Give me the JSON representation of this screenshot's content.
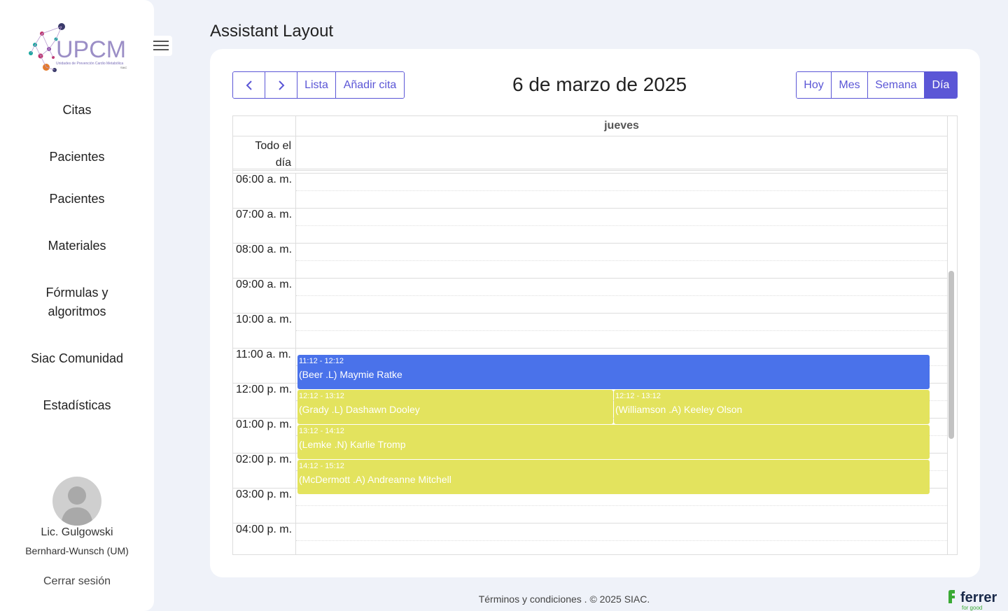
{
  "sidebar": {
    "logo_text": "UPCM",
    "logo_subtitle": "Unidades de Prevención Cardio Metabólica",
    "logo_tag": "SIAC",
    "items": [
      {
        "label": "Citas"
      },
      {
        "label": "Pacientes"
      },
      {
        "label": "Pacientes"
      },
      {
        "label": "Materiales"
      },
      {
        "label": "Fórmulas y algoritmos"
      },
      {
        "label": "Siac Comunidad"
      },
      {
        "label": "Estadísticas"
      }
    ],
    "user_name": "Lic. Gulgowski",
    "user_org": "Bernhard-Wunsch (UM)",
    "logout": "Cerrar sesión"
  },
  "page": {
    "title": "Assistant Layout"
  },
  "toolbar": {
    "prev_icon": "chevron-left-icon",
    "next_icon": "chevron-right-icon",
    "list_label": "Lista",
    "add_label": "Añadir cita",
    "title": "6 de marzo de 2025",
    "views": [
      {
        "label": "Hoy",
        "active": false
      },
      {
        "label": "Mes",
        "active": false
      },
      {
        "label": "Semana",
        "active": false
      },
      {
        "label": "Día",
        "active": true
      }
    ]
  },
  "calendar": {
    "day_header": "jueves",
    "allday_label": "Todo el día",
    "times": [
      "06:00 a. m.",
      "07:00 a. m.",
      "08:00 a. m.",
      "09:00 a. m.",
      "10:00 a. m.",
      "11:00 a. m.",
      "12:00 p. m.",
      "01:00 p. m.",
      "02:00 p. m.",
      "03:00 p. m.",
      "04:00 p. m."
    ],
    "events": [
      {
        "time": "11:12 - 12:12",
        "title": "(Beer .L) Maymie Ratke",
        "color": "#4a72ea"
      },
      {
        "time": "12:12 - 13:12",
        "title": "(Grady .L) Dashawn Dooley",
        "color": "#e3e35e"
      },
      {
        "time": "12:12 - 13:12",
        "title": "(Williamson .A) Keeley Olson",
        "color": "#e3e35e"
      },
      {
        "time": "13:12 - 14:12",
        "title": "(Lemke .N) Karlie Tromp",
        "color": "#e3e35e"
      },
      {
        "time": "14:12 - 15:12",
        "title": "(McDermott .A) Andreanne Mitchell",
        "color": "#e3e35e"
      }
    ]
  },
  "footer": {
    "text": "Términos y condiciones . © 2025 SIAC."
  },
  "brand": {
    "name": "ferrer",
    "tagline": "for good"
  },
  "colors": {
    "accent": "#5b56d6",
    "background": "#eff2f9"
  }
}
